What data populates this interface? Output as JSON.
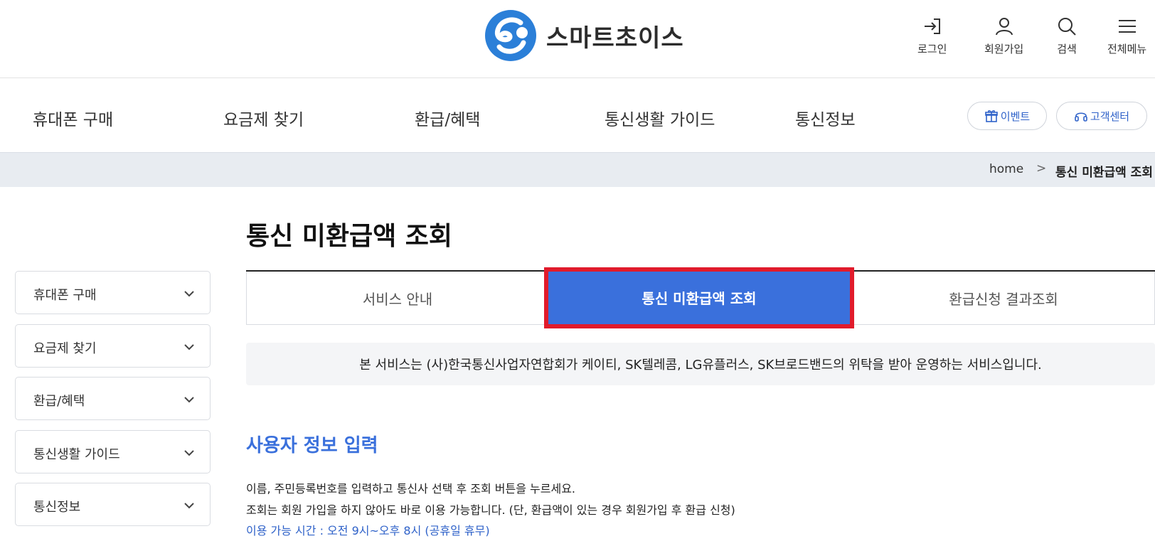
{
  "header": {
    "logo_text": "스마트초이스",
    "utility": [
      {
        "label": "로그인",
        "icon": "login-icon"
      },
      {
        "label": "회원가입",
        "icon": "user-icon"
      },
      {
        "label": "검색",
        "icon": "search-icon"
      },
      {
        "label": "전체메뉴",
        "icon": "menu-icon"
      }
    ]
  },
  "gnb": {
    "items": [
      "휴대폰 구매",
      "요금제 찾기",
      "환급/혜택",
      "통신생활 가이드",
      "통신정보"
    ],
    "event_label": "이벤트",
    "support_label": "고객센터"
  },
  "breadcrumb": {
    "home": "home",
    "separator": ">",
    "current": "통신 미환급액 조회"
  },
  "side_menu": {
    "items": [
      "휴대폰 구매",
      "요금제 찾기",
      "환급/혜택",
      "통신생활 가이드",
      "통신정보"
    ]
  },
  "main": {
    "title": "통신 미환급액 조회",
    "tabs": [
      {
        "label": "서비스 안내",
        "active": false
      },
      {
        "label": "통신 미환급액 조회",
        "active": true
      },
      {
        "label": "환급신청 결과조회",
        "active": false
      }
    ],
    "notice": "본 서비스는 (사)한국통신사업자연합회가 케이티, SK텔레콤, LG유플러스, SK브로드밴드의 위탁을 받아 운영하는 서비스입니다.",
    "section_title": "사용자 정보 입력",
    "desc_1": "이름, 주민등록번호를 입력하고 통신사 선택 후 조회 버튼을 누르세요.",
    "desc_2": "조회는 회원 가입을 하지 않아도 바로 이용 가능합니다. (단, 환급액이 있는 경우 회원가입 후 환급 신청)",
    "desc_3": "이용 가능 시간 : 오전 9시~오후 8시 (공휴일 휴무)"
  },
  "colors": {
    "accent": "#3a70dc",
    "highlight_border": "#e11b2b",
    "breadcrumb_bg": "#e8ecf1",
    "notice_bg": "#f4f5f7"
  }
}
